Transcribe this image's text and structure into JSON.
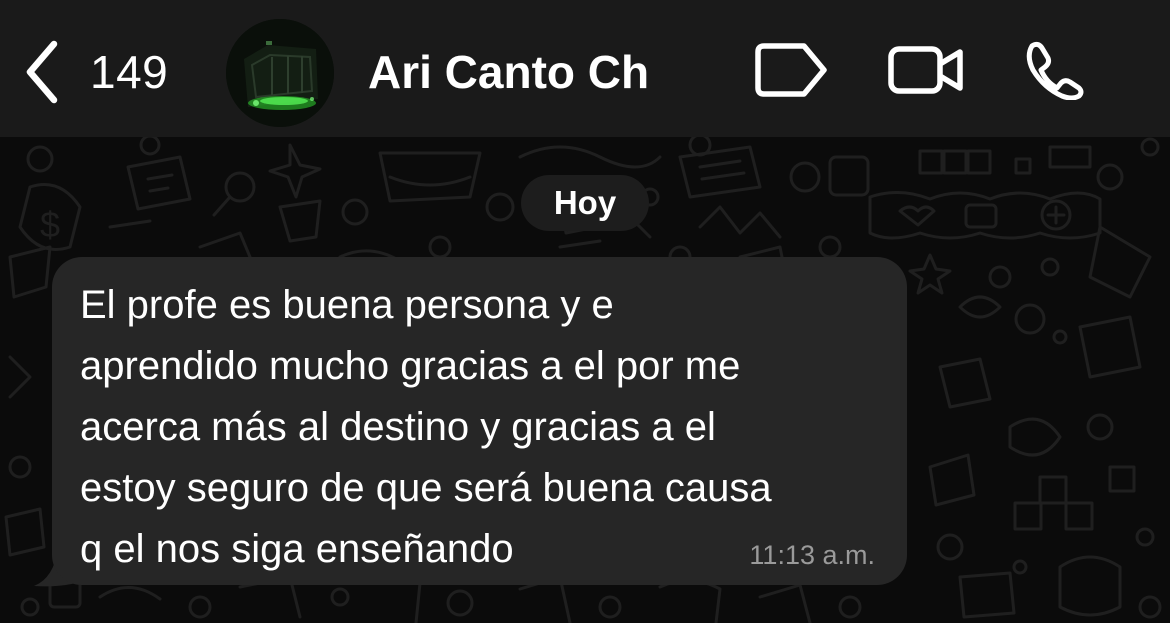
{
  "header": {
    "back_count": "149",
    "contact_name": "Ari Canto Ch",
    "icons": {
      "back": "chevron-left-icon",
      "label": "label-tag-icon",
      "video": "video-camera-icon",
      "call": "phone-icon"
    }
  },
  "chat": {
    "date_label": "Hoy",
    "messages": [
      {
        "text": "El profe es buena persona y e\naprendido mucho gracias a el por me\nacerca más al destino y gracias a el\nestoy seguro de que será buena causa\nq el nos siga enseñando",
        "time": "11:13 a.m.",
        "direction": "incoming"
      }
    ]
  },
  "colors": {
    "header_bg": "#1a1a1a",
    "chat_bg": "#0b0b0b",
    "bubble_bg": "#262626",
    "text": "#ffffff",
    "time_text": "#9a9a9a"
  }
}
